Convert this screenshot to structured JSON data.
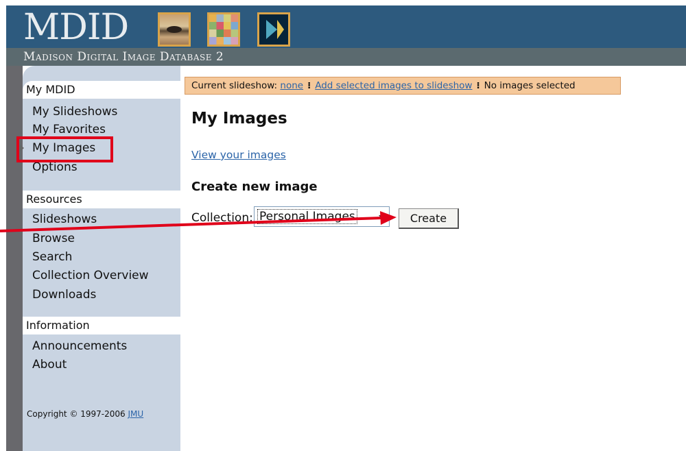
{
  "header": {
    "logo_text": "MDID",
    "subtitle": "Madison Digital Image Database 2"
  },
  "sidebar": {
    "sections": [
      {
        "title": "My MDID",
        "items": [
          "My Slideshows",
          "My Favorites",
          "My Images",
          "Options"
        ]
      },
      {
        "title": "Resources",
        "items": [
          "Slideshows",
          "Browse",
          "Search",
          "Collection Overview",
          "Downloads"
        ]
      },
      {
        "title": "Information",
        "items": [
          "Announcements",
          "About"
        ]
      }
    ],
    "copyright_text": "Copyright © 1997-2006",
    "copyright_link": "JMU"
  },
  "slideshow_bar": {
    "label": "Current slideshow:",
    "current_link": "none",
    "add_link": "Add selected images to slideshow",
    "status": "No images selected"
  },
  "main": {
    "title": "My Images",
    "view_link": "View your images",
    "create_title": "Create new image",
    "collection_label": "Collection:",
    "collection_value": "Personal Images",
    "create_button": "Create"
  },
  "colors": {
    "header_bg": "#2d5a7e",
    "sidebar_bg": "#c9d4e2",
    "slideshow_bar_bg": "#f5c89a",
    "link": "#2b64a8",
    "annotation": "#e0001a"
  }
}
